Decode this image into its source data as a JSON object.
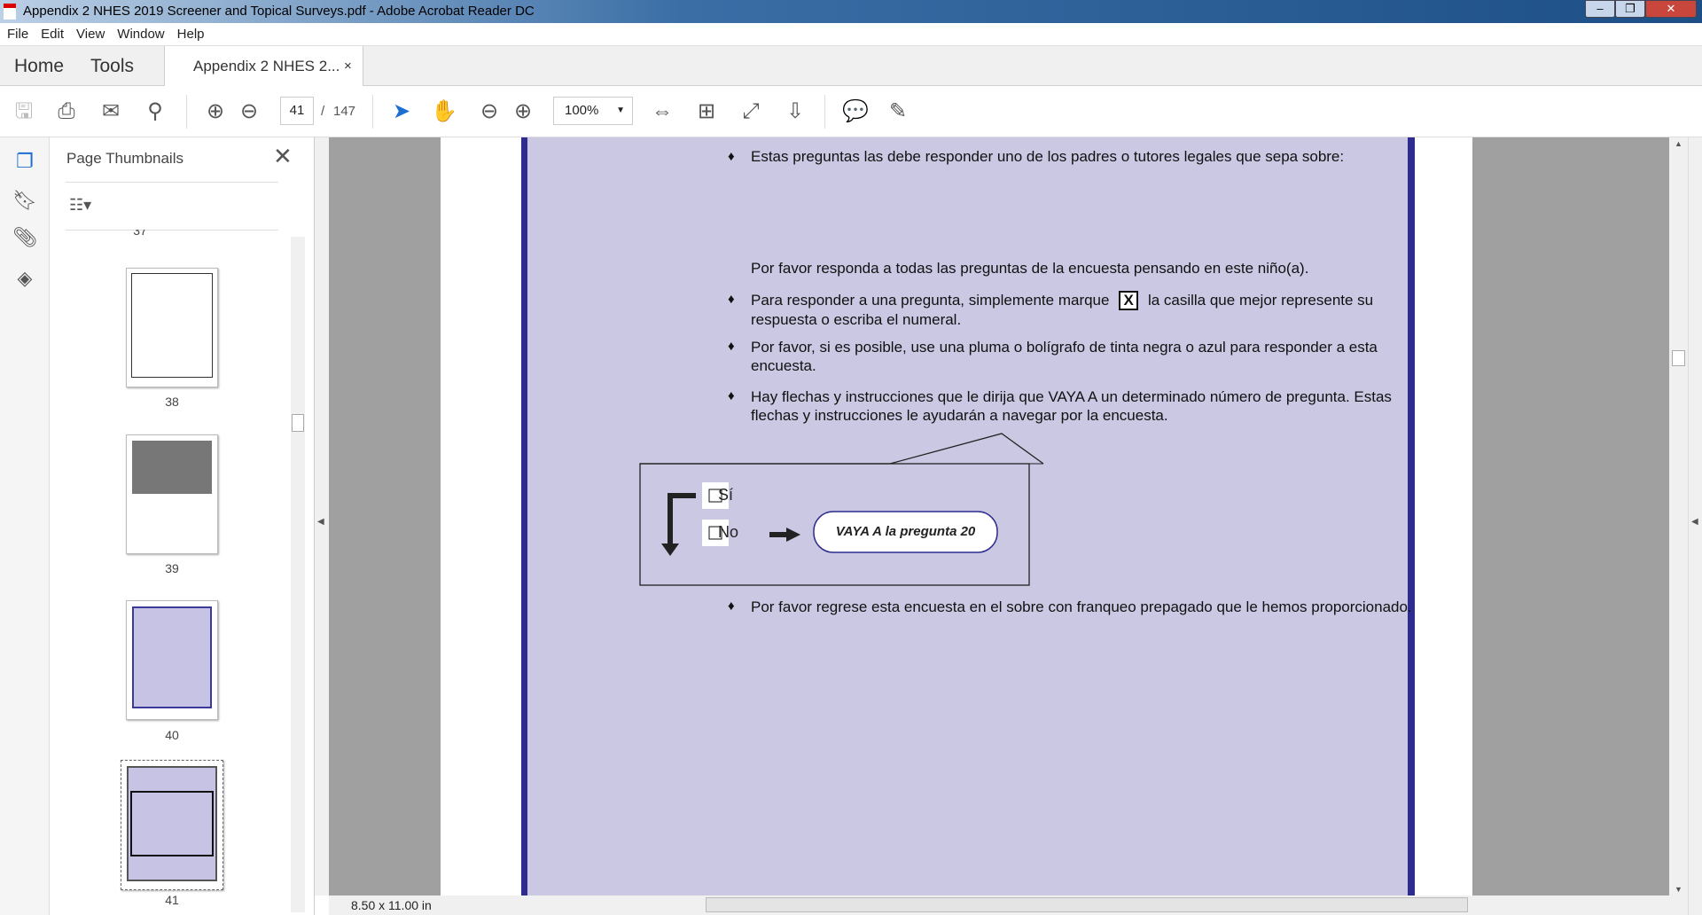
{
  "window": {
    "title": "Appendix 2 NHES 2019 Screener and Topical Surveys.pdf - Adobe Acrobat Reader DC"
  },
  "menu": [
    "File",
    "Edit",
    "View",
    "Window",
    "Help"
  ],
  "tabs": {
    "home": "Home",
    "tools": "Tools",
    "document": "Appendix 2 NHES 2...",
    "close": "×"
  },
  "toolbar": {
    "page_current": "41",
    "page_separator": "/",
    "page_total": "147",
    "zoom": "100%"
  },
  "thumbnails": {
    "title": "Page Thumbnails",
    "pages": [
      "37",
      "38",
      "39",
      "40",
      "41"
    ],
    "current": "41"
  },
  "document": {
    "bullet1": "Estas preguntas las debe responder uno de los padres o tutores legales que sepa sobre:",
    "para": "Por favor responda a todas las preguntas de la encuesta pensando en este niño(a).",
    "bullet2a": "Para responder a una pregunta, simplemente marque",
    "checked_mark": "X",
    "bullet2b": "la casilla que mejor represente su respuesta o escriba el numeral.",
    "bullet3": "Por favor, si es posible, use una pluma o bolígrafo de tinta negra o azul para responder a esta encuesta.",
    "bullet4": "Hay flechas y instrucciones que le dirija que VAYA A un determinado número de pregunta. Estas flechas y instrucciones le ayudarán a navegar por la encuesta.",
    "example": {
      "yes": "Sí",
      "no": "No",
      "skip": "VAYA A la pregunta 20"
    },
    "bullet5": "Por favor regrese esta encuesta en el sobre con franqueo prepagado que le hemos proporcionado."
  },
  "status": {
    "page_size": "8.50 x 11.00 in"
  },
  "colors": {
    "page_band": "#cbc8e4",
    "border": "#2e2d8f"
  }
}
